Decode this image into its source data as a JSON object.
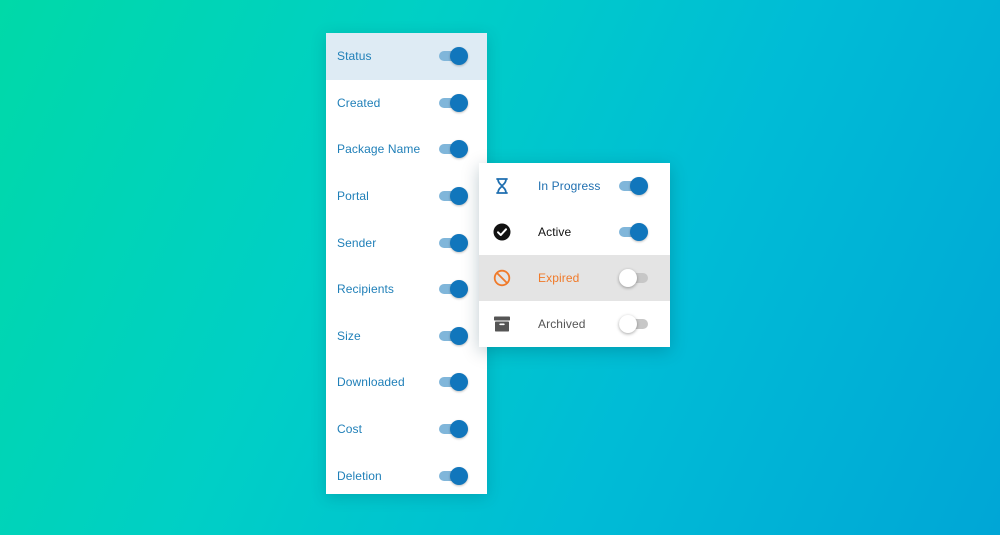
{
  "columns_panel": {
    "items": [
      {
        "label": "Status",
        "enabled": true,
        "highlighted": true
      },
      {
        "label": "Created",
        "enabled": true
      },
      {
        "label": "Package Name",
        "enabled": true
      },
      {
        "label": "Portal",
        "enabled": true
      },
      {
        "label": "Sender",
        "enabled": true
      },
      {
        "label": "Recipients",
        "enabled": true
      },
      {
        "label": "Size",
        "enabled": true
      },
      {
        "label": "Downloaded",
        "enabled": true
      },
      {
        "label": "Cost",
        "enabled": true
      },
      {
        "label": "Deletion",
        "enabled": true
      }
    ]
  },
  "status_panel": {
    "items": [
      {
        "label": "In Progress",
        "icon": "hourglass-icon",
        "enabled": true,
        "color": "#1f6fb0"
      },
      {
        "label": "Active",
        "icon": "check-circle-icon",
        "enabled": true,
        "color": "#111111"
      },
      {
        "label": "Expired",
        "icon": "prohibited-icon",
        "enabled": false,
        "color": "#f07a2a",
        "highlighted": true
      },
      {
        "label": "Archived",
        "icon": "archive-box-icon",
        "enabled": false,
        "color": "#555555"
      }
    ]
  },
  "colors": {
    "accent": "#1176bc",
    "accent_track": "#80b6da",
    "label_blue": "#1f7fb8",
    "expired_orange": "#f07a2a"
  }
}
